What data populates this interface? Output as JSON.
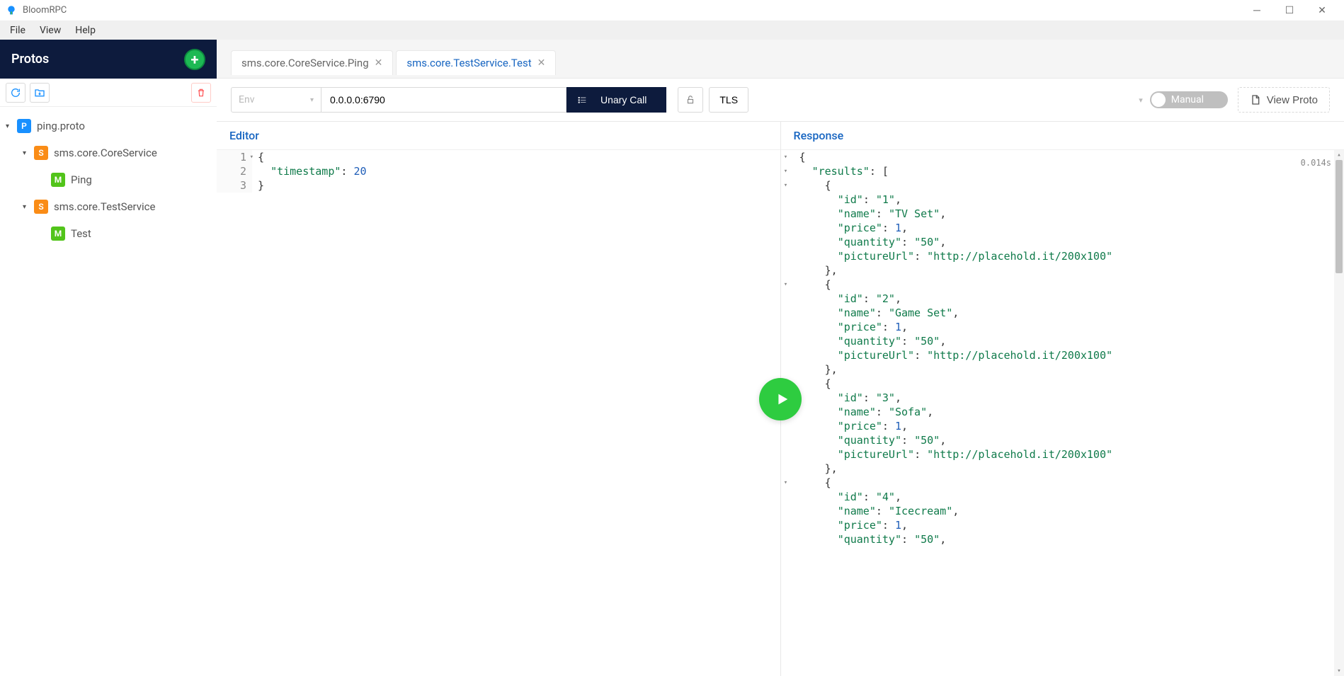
{
  "app": {
    "title": "BloomRPC"
  },
  "menubar": {
    "items": [
      "File",
      "View",
      "Help"
    ]
  },
  "sidebar": {
    "title": "Protos",
    "tree": [
      {
        "type": "proto",
        "badge": "P",
        "label": "ping.proto",
        "level": 0,
        "expanded": true
      },
      {
        "type": "service",
        "badge": "S",
        "label": "sms.core.CoreService",
        "level": 1,
        "expanded": true
      },
      {
        "type": "method",
        "badge": "M",
        "label": "Ping",
        "level": 2
      },
      {
        "type": "service",
        "badge": "S",
        "label": "sms.core.TestService",
        "level": 1,
        "expanded": true
      },
      {
        "type": "method",
        "badge": "M",
        "label": "Test",
        "level": 2
      }
    ]
  },
  "tabs": [
    {
      "label": "sms.core.CoreService.Ping",
      "active": false
    },
    {
      "label": "sms.core.TestService.Test",
      "active": true
    }
  ],
  "addrbar": {
    "env_placeholder": "Env",
    "address": "0.0.0.0:6790",
    "call_label": "Unary Call",
    "tls_label": "TLS",
    "toggle_label": "Manual",
    "view_proto_label": "View Proto"
  },
  "editor": {
    "title": "Editor",
    "lines": [
      {
        "n": "1",
        "fold": true,
        "tokens": [
          [
            "pun",
            "{"
          ]
        ]
      },
      {
        "n": "2",
        "tokens": [
          [
            "pun",
            "  "
          ],
          [
            "key",
            "\"timestamp\""
          ],
          [
            "pun",
            ": "
          ],
          [
            "num",
            "20"
          ]
        ]
      },
      {
        "n": "3",
        "tokens": [
          [
            "pun",
            "}"
          ]
        ]
      }
    ]
  },
  "response": {
    "title": "Response",
    "timing": "0.014s",
    "lines": [
      {
        "fold": true,
        "tokens": [
          [
            "pun",
            "{"
          ]
        ]
      },
      {
        "fold": true,
        "tokens": [
          [
            "pun",
            "  "
          ],
          [
            "key",
            "\"results\""
          ],
          [
            "pun",
            ": ["
          ]
        ]
      },
      {
        "fold": true,
        "tokens": [
          [
            "pun",
            "    {"
          ]
        ]
      },
      {
        "tokens": [
          [
            "pun",
            "      "
          ],
          [
            "key",
            "\"id\""
          ],
          [
            "pun",
            ": "
          ],
          [
            "str",
            "\"1\""
          ],
          [
            "pun",
            ","
          ]
        ]
      },
      {
        "tokens": [
          [
            "pun",
            "      "
          ],
          [
            "key",
            "\"name\""
          ],
          [
            "pun",
            ": "
          ],
          [
            "str",
            "\"TV Set\""
          ],
          [
            "pun",
            ","
          ]
        ]
      },
      {
        "tokens": [
          [
            "pun",
            "      "
          ],
          [
            "key",
            "\"price\""
          ],
          [
            "pun",
            ": "
          ],
          [
            "num",
            "1"
          ],
          [
            "pun",
            ","
          ]
        ]
      },
      {
        "tokens": [
          [
            "pun",
            "      "
          ],
          [
            "key",
            "\"quantity\""
          ],
          [
            "pun",
            ": "
          ],
          [
            "str",
            "\"50\""
          ],
          [
            "pun",
            ","
          ]
        ]
      },
      {
        "tokens": [
          [
            "pun",
            "      "
          ],
          [
            "key",
            "\"pictureUrl\""
          ],
          [
            "pun",
            ": "
          ],
          [
            "str",
            "\"http://placehold.it/200x100\""
          ]
        ]
      },
      {
        "tokens": [
          [
            "pun",
            "    },"
          ]
        ]
      },
      {
        "fold": true,
        "tokens": [
          [
            "pun",
            "    {"
          ]
        ]
      },
      {
        "tokens": [
          [
            "pun",
            "      "
          ],
          [
            "key",
            "\"id\""
          ],
          [
            "pun",
            ": "
          ],
          [
            "str",
            "\"2\""
          ],
          [
            "pun",
            ","
          ]
        ]
      },
      {
        "tokens": [
          [
            "pun",
            "      "
          ],
          [
            "key",
            "\"name\""
          ],
          [
            "pun",
            ": "
          ],
          [
            "str",
            "\"Game Set\""
          ],
          [
            "pun",
            ","
          ]
        ]
      },
      {
        "tokens": [
          [
            "pun",
            "      "
          ],
          [
            "key",
            "\"price\""
          ],
          [
            "pun",
            ": "
          ],
          [
            "num",
            "1"
          ],
          [
            "pun",
            ","
          ]
        ]
      },
      {
        "tokens": [
          [
            "pun",
            "      "
          ],
          [
            "key",
            "\"quantity\""
          ],
          [
            "pun",
            ": "
          ],
          [
            "str",
            "\"50\""
          ],
          [
            "pun",
            ","
          ]
        ]
      },
      {
        "tokens": [
          [
            "pun",
            "      "
          ],
          [
            "key",
            "\"pictureUrl\""
          ],
          [
            "pun",
            ": "
          ],
          [
            "str",
            "\"http://placehold.it/200x100\""
          ]
        ]
      },
      {
        "tokens": [
          [
            "pun",
            "    },"
          ]
        ]
      },
      {
        "fold": true,
        "tokens": [
          [
            "pun",
            "    {"
          ]
        ]
      },
      {
        "tokens": [
          [
            "pun",
            "      "
          ],
          [
            "key",
            "\"id\""
          ],
          [
            "pun",
            ": "
          ],
          [
            "str",
            "\"3\""
          ],
          [
            "pun",
            ","
          ]
        ]
      },
      {
        "tokens": [
          [
            "pun",
            "      "
          ],
          [
            "key",
            "\"name\""
          ],
          [
            "pun",
            ": "
          ],
          [
            "str",
            "\"Sofa\""
          ],
          [
            "pun",
            ","
          ]
        ]
      },
      {
        "tokens": [
          [
            "pun",
            "      "
          ],
          [
            "key",
            "\"price\""
          ],
          [
            "pun",
            ": "
          ],
          [
            "num",
            "1"
          ],
          [
            "pun",
            ","
          ]
        ]
      },
      {
        "tokens": [
          [
            "pun",
            "      "
          ],
          [
            "key",
            "\"quantity\""
          ],
          [
            "pun",
            ": "
          ],
          [
            "str",
            "\"50\""
          ],
          [
            "pun",
            ","
          ]
        ]
      },
      {
        "tokens": [
          [
            "pun",
            "      "
          ],
          [
            "key",
            "\"pictureUrl\""
          ],
          [
            "pun",
            ": "
          ],
          [
            "str",
            "\"http://placehold.it/200x100\""
          ]
        ]
      },
      {
        "tokens": [
          [
            "pun",
            "    },"
          ]
        ]
      },
      {
        "fold": true,
        "tokens": [
          [
            "pun",
            "    {"
          ]
        ]
      },
      {
        "tokens": [
          [
            "pun",
            "      "
          ],
          [
            "key",
            "\"id\""
          ],
          [
            "pun",
            ": "
          ],
          [
            "str",
            "\"4\""
          ],
          [
            "pun",
            ","
          ]
        ]
      },
      {
        "tokens": [
          [
            "pun",
            "      "
          ],
          [
            "key",
            "\"name\""
          ],
          [
            "pun",
            ": "
          ],
          [
            "str",
            "\"Icecream\""
          ],
          [
            "pun",
            ","
          ]
        ]
      },
      {
        "tokens": [
          [
            "pun",
            "      "
          ],
          [
            "key",
            "\"price\""
          ],
          [
            "pun",
            ": "
          ],
          [
            "num",
            "1"
          ],
          [
            "pun",
            ","
          ]
        ]
      },
      {
        "tokens": [
          [
            "pun",
            "      "
          ],
          [
            "key",
            "\"quantity\""
          ],
          [
            "pun",
            ": "
          ],
          [
            "str",
            "\"50\""
          ],
          [
            "pun",
            ","
          ]
        ]
      }
    ]
  }
}
